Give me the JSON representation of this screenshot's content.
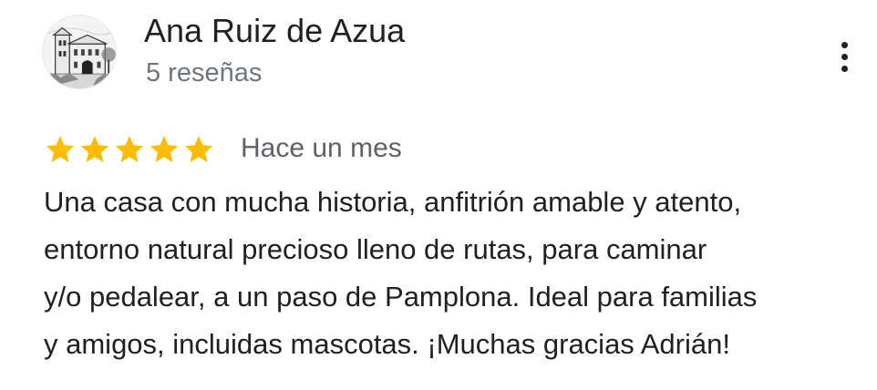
{
  "review": {
    "author_name": "Ana Ruiz de Azua",
    "author_reviews": "5 reseñas",
    "avatar_icon": "building-photo-avatar",
    "menu_icon": "more-vert-icon",
    "rating": 5,
    "rating_max": 5,
    "star_color": "#fbbc04",
    "time": "Hace un mes",
    "text_lines": [
      "Una casa con mucha historia, anfitrión amable y atento,",
      "entorno natural precioso lleno de rutas, para caminar",
      "y/o pedalear, a un paso de Pamplona. Ideal para familias",
      "y amigos, incluidas mascotas. ¡Muchas gracias Adrián!"
    ]
  }
}
